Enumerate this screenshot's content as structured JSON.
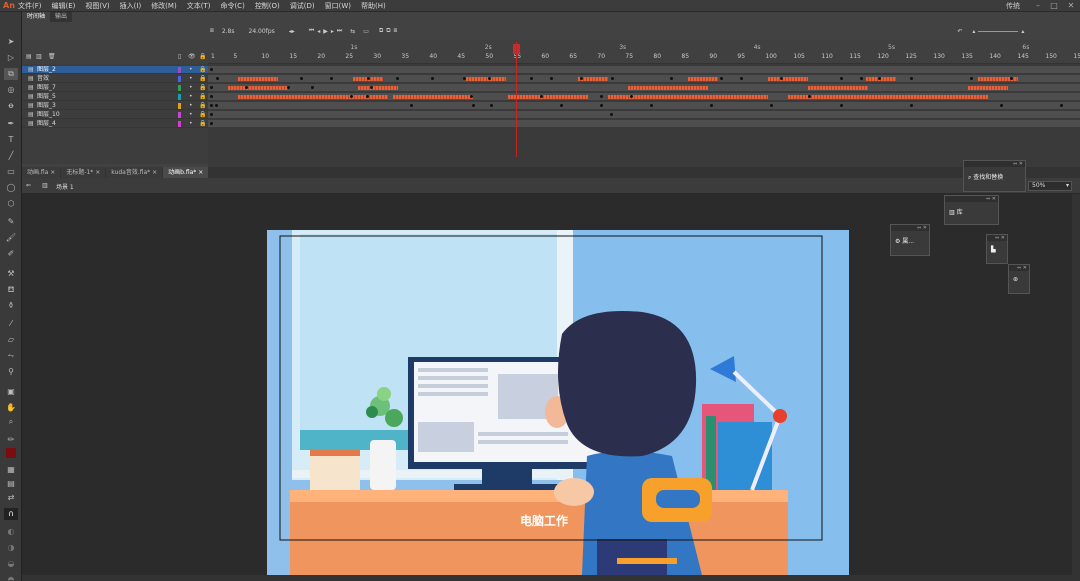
{
  "menubar": {
    "logo": "An",
    "items": [
      "文件(F)",
      "编辑(E)",
      "视图(V)",
      "插入(I)",
      "修改(M)",
      "文本(T)",
      "命令(C)",
      "控制(O)",
      "调试(D)",
      "窗口(W)",
      "帮助(H)"
    ],
    "mode": "传统"
  },
  "timeline": {
    "tabs": [
      "时间轴",
      "输出"
    ],
    "fps": "24.00",
    "fps_unit": "fps",
    "time": "2.8",
    "time_unit": "s",
    "seconds": [
      "1s",
      "2s",
      "3s",
      "4s",
      "5s",
      "6s",
      "7s"
    ],
    "ruler": [
      "1",
      "5",
      "10",
      "15",
      "20",
      "25",
      "30",
      "35",
      "40",
      "45",
      "50",
      "55",
      "60",
      "65",
      "70",
      "75",
      "80",
      "85",
      "90",
      "95",
      "100",
      "105",
      "110",
      "115",
      "120",
      "125",
      "130",
      "135",
      "140",
      "145",
      "150",
      "155",
      "160",
      "165",
      "170",
      "175",
      "180",
      "185",
      "190"
    ],
    "layers": [
      {
        "name": "图层_2",
        "color": "#9b4dc8",
        "selected": true
      },
      {
        "name": "音效",
        "color": "#4a66e0"
      },
      {
        "name": "图层_7",
        "color": "#35a050"
      },
      {
        "name": "图层_5",
        "color": "#1c9cb0"
      },
      {
        "name": "图层_3",
        "color": "#e0a020"
      },
      {
        "name": "图层_10",
        "color": "#c04ad0"
      },
      {
        "name": "图层_4",
        "color": "#d040c8"
      }
    ]
  },
  "doc_tabs": [
    "动画.fla",
    "无标题-1*",
    "kuda音效.fla*",
    "动画b.fla*"
  ],
  "scene": {
    "label": "场景 1",
    "zoom": "50%"
  },
  "panels": {
    "find_replace": "查找和替换",
    "library": "库",
    "properties": "属..."
  },
  "stage": {
    "subtitle": "电脑工作"
  }
}
